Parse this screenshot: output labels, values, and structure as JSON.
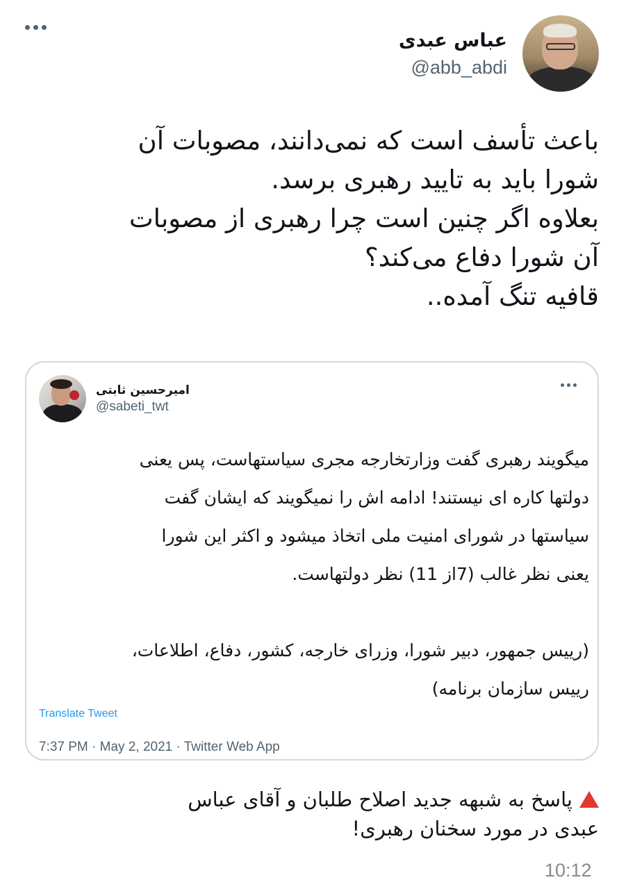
{
  "author": {
    "name": "عباس عبدی",
    "handle": "@abb_abdi"
  },
  "tweet": {
    "lines": [
      "باعث تأسف است که نمی‌دانند، مصوبات آن",
      "شورا باید به تایید رهبری برسد.",
      "بعلاوه اگر چنین است چرا رهبری از مصوبات",
      "آن شورا دفاع می‌کند؟",
      "قافیه تنگ آمده.."
    ]
  },
  "quoted": {
    "name": "امیرحسین ثابتی",
    "handle": "@sabeti_twt",
    "lines": [
      "میگویند رهبری گفت وزارتخارجه مجری سیاستهاست، پس یعنی",
      "دولتها کاره ای نیستند! ادامه اش را نمیگویند که ایشان گفت",
      "سیاستها در شورای امنیت ملی اتخاذ میشود و اکثر این شورا",
      "یعنی نظر غالب (7از 11) نظر دولتهاست."
    ],
    "lines2": [
      "(رییس جمهور، دبیر شورا، وزرای خارجه، کشور، دفاع، اطلاعات،",
      "رییس سازمان برنامه)"
    ],
    "translate_label": "Translate Tweet",
    "meta": "7:37 PM · May 2, 2021 · Twitter Web App"
  },
  "reply": {
    "lines": [
      "پاسخ به شبهه جدید اصلاح طلبان و آقای عباس",
      "عبدی در مورد سخنان رهبری!"
    ],
    "time": "10:12"
  },
  "icons": {
    "more": "more-horizontal-icon",
    "warning": "red-triangle-icon"
  },
  "colors": {
    "link": "#1d9bf0",
    "secondary_text": "#536471",
    "border": "#cfd9de",
    "triangle": "#e03a2f"
  }
}
